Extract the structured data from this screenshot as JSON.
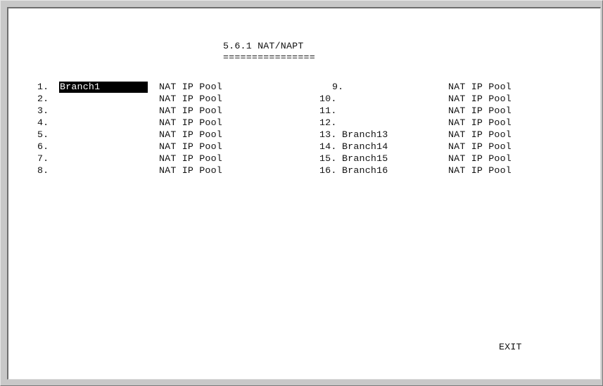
{
  "screen": {
    "title": "5.6.1 NAT/NAPT",
    "underline": "================"
  },
  "left_column": [
    {
      "number": "1.",
      "name": "Branch1",
      "pool": "NAT IP Pool"
    },
    {
      "number": "2.",
      "name": "",
      "pool": "NAT IP Pool"
    },
    {
      "number": "3.",
      "name": "",
      "pool": "NAT IP Pool"
    },
    {
      "number": "4.",
      "name": "",
      "pool": "NAT IP Pool"
    },
    {
      "number": "5.",
      "name": "",
      "pool": "NAT IP Pool"
    },
    {
      "number": "6.",
      "name": "",
      "pool": "NAT IP Pool"
    },
    {
      "number": "7.",
      "name": "",
      "pool": "NAT IP Pool"
    },
    {
      "number": "8.",
      "name": "",
      "pool": "NAT IP Pool"
    }
  ],
  "right_column": [
    {
      "number": "9.",
      "name": "",
      "pool": "NAT IP Pool"
    },
    {
      "number": "10.",
      "name": "",
      "pool": "NAT IP Pool"
    },
    {
      "number": "11.",
      "name": "",
      "pool": "NAT IP Pool"
    },
    {
      "number": "12.",
      "name": "",
      "pool": "NAT IP Pool"
    },
    {
      "number": "13.",
      "name": "Branch13",
      "pool": "NAT IP Pool"
    },
    {
      "number": "14.",
      "name": "Branch14",
      "pool": "NAT IP Pool"
    },
    {
      "number": "15.",
      "name": "Branch15",
      "pool": "NAT IP Pool"
    },
    {
      "number": "16.",
      "name": "Branch16",
      "pool": "NAT IP Pool"
    }
  ],
  "footer": {
    "exit_label": "EXIT"
  }
}
